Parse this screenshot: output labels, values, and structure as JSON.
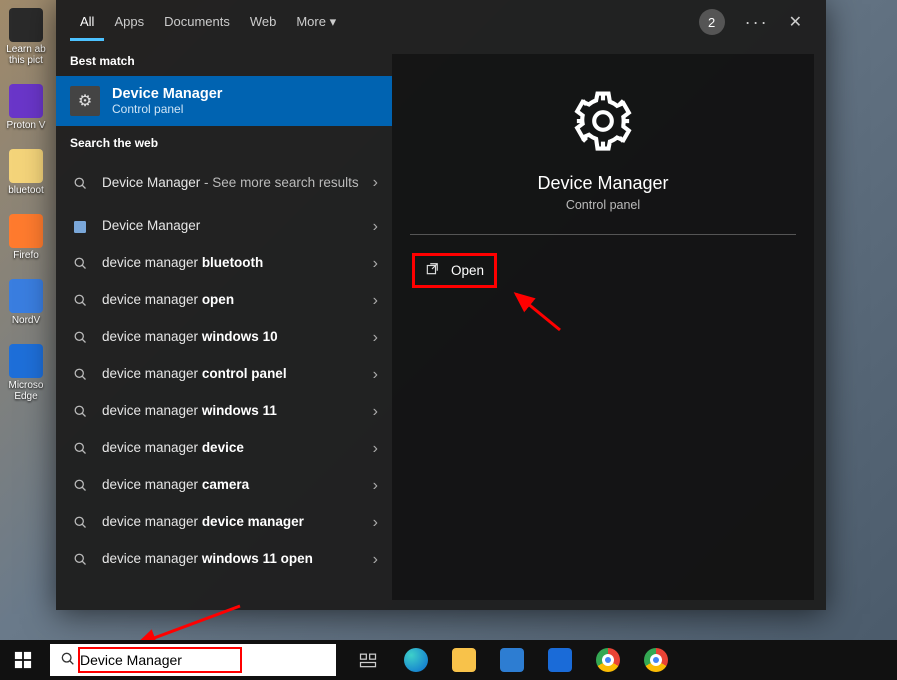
{
  "desktop_icons": [
    {
      "label": "Learn ab\nthis pict",
      "color": "#2a2a2a"
    },
    {
      "label": "Proton V",
      "color": "#6a36c9"
    },
    {
      "label": "bluetoot",
      "color": "#f4d47a"
    },
    {
      "label": "Firefo",
      "color": "#ff7b2e"
    },
    {
      "label": "NordV",
      "color": "#3a7ee0"
    },
    {
      "label": "Microso\nEdge",
      "color": "#1e6fd9"
    }
  ],
  "tabs": {
    "items": [
      "All",
      "Apps",
      "Documents",
      "Web",
      "More"
    ],
    "active_index": 0,
    "badge": "2"
  },
  "best_match": {
    "section_label": "Best match",
    "title": "Device Manager",
    "subtitle": "Control panel"
  },
  "web_section_label": "Search the web",
  "web_results": [
    {
      "prefix": "Device Manager",
      "suffix": " - See more search results",
      "bold_tail": "",
      "tall": true
    },
    {
      "plain": "Device Manager",
      "icon": "app"
    },
    {
      "prefix": "device manager ",
      "bold_tail": "bluetooth"
    },
    {
      "prefix": "device manager ",
      "bold_tail": "open"
    },
    {
      "prefix": "device manager ",
      "bold_tail": "windows 10"
    },
    {
      "prefix": "device manager ",
      "bold_tail": "control panel"
    },
    {
      "prefix": "device manager ",
      "bold_tail": "windows 11"
    },
    {
      "prefix": "device manager ",
      "bold_tail": "device"
    },
    {
      "prefix": "device manager ",
      "bold_tail": "camera"
    },
    {
      "prefix": "device manager ",
      "bold_tail": "device manager"
    },
    {
      "prefix": "device manager ",
      "bold_tail": "windows 11 open"
    }
  ],
  "preview": {
    "title": "Device Manager",
    "subtitle": "Control panel",
    "open_label": "Open"
  },
  "searchbox": {
    "value": "Device Manager"
  }
}
